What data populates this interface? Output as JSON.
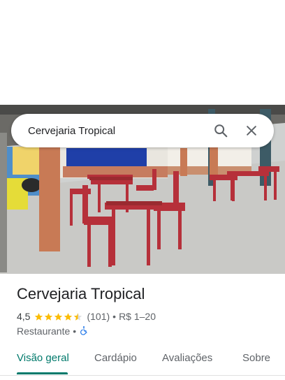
{
  "search": {
    "query": "Cervejaria Tropical"
  },
  "place": {
    "name": "Cervejaria Tropical",
    "rating": "4,5",
    "review_count": "(101)",
    "separator": "•",
    "price_range": "R$ 1–20",
    "category": "Restaurante",
    "category_separator": "•",
    "accessibility_icon": "wheelchair-icon",
    "stars_filled": 4.5,
    "star_color": "#fbbc04"
  },
  "tabs": [
    {
      "label": "Visão geral",
      "active": true
    },
    {
      "label": "Cardápio",
      "active": false
    },
    {
      "label": "Avaliações",
      "active": false
    },
    {
      "label": "Sobre",
      "active": false
    }
  ],
  "colors": {
    "accent": "#00796b",
    "accessibility_icon": "#1a73e8"
  },
  "icons": {
    "search": "search-icon",
    "close": "close-icon"
  }
}
